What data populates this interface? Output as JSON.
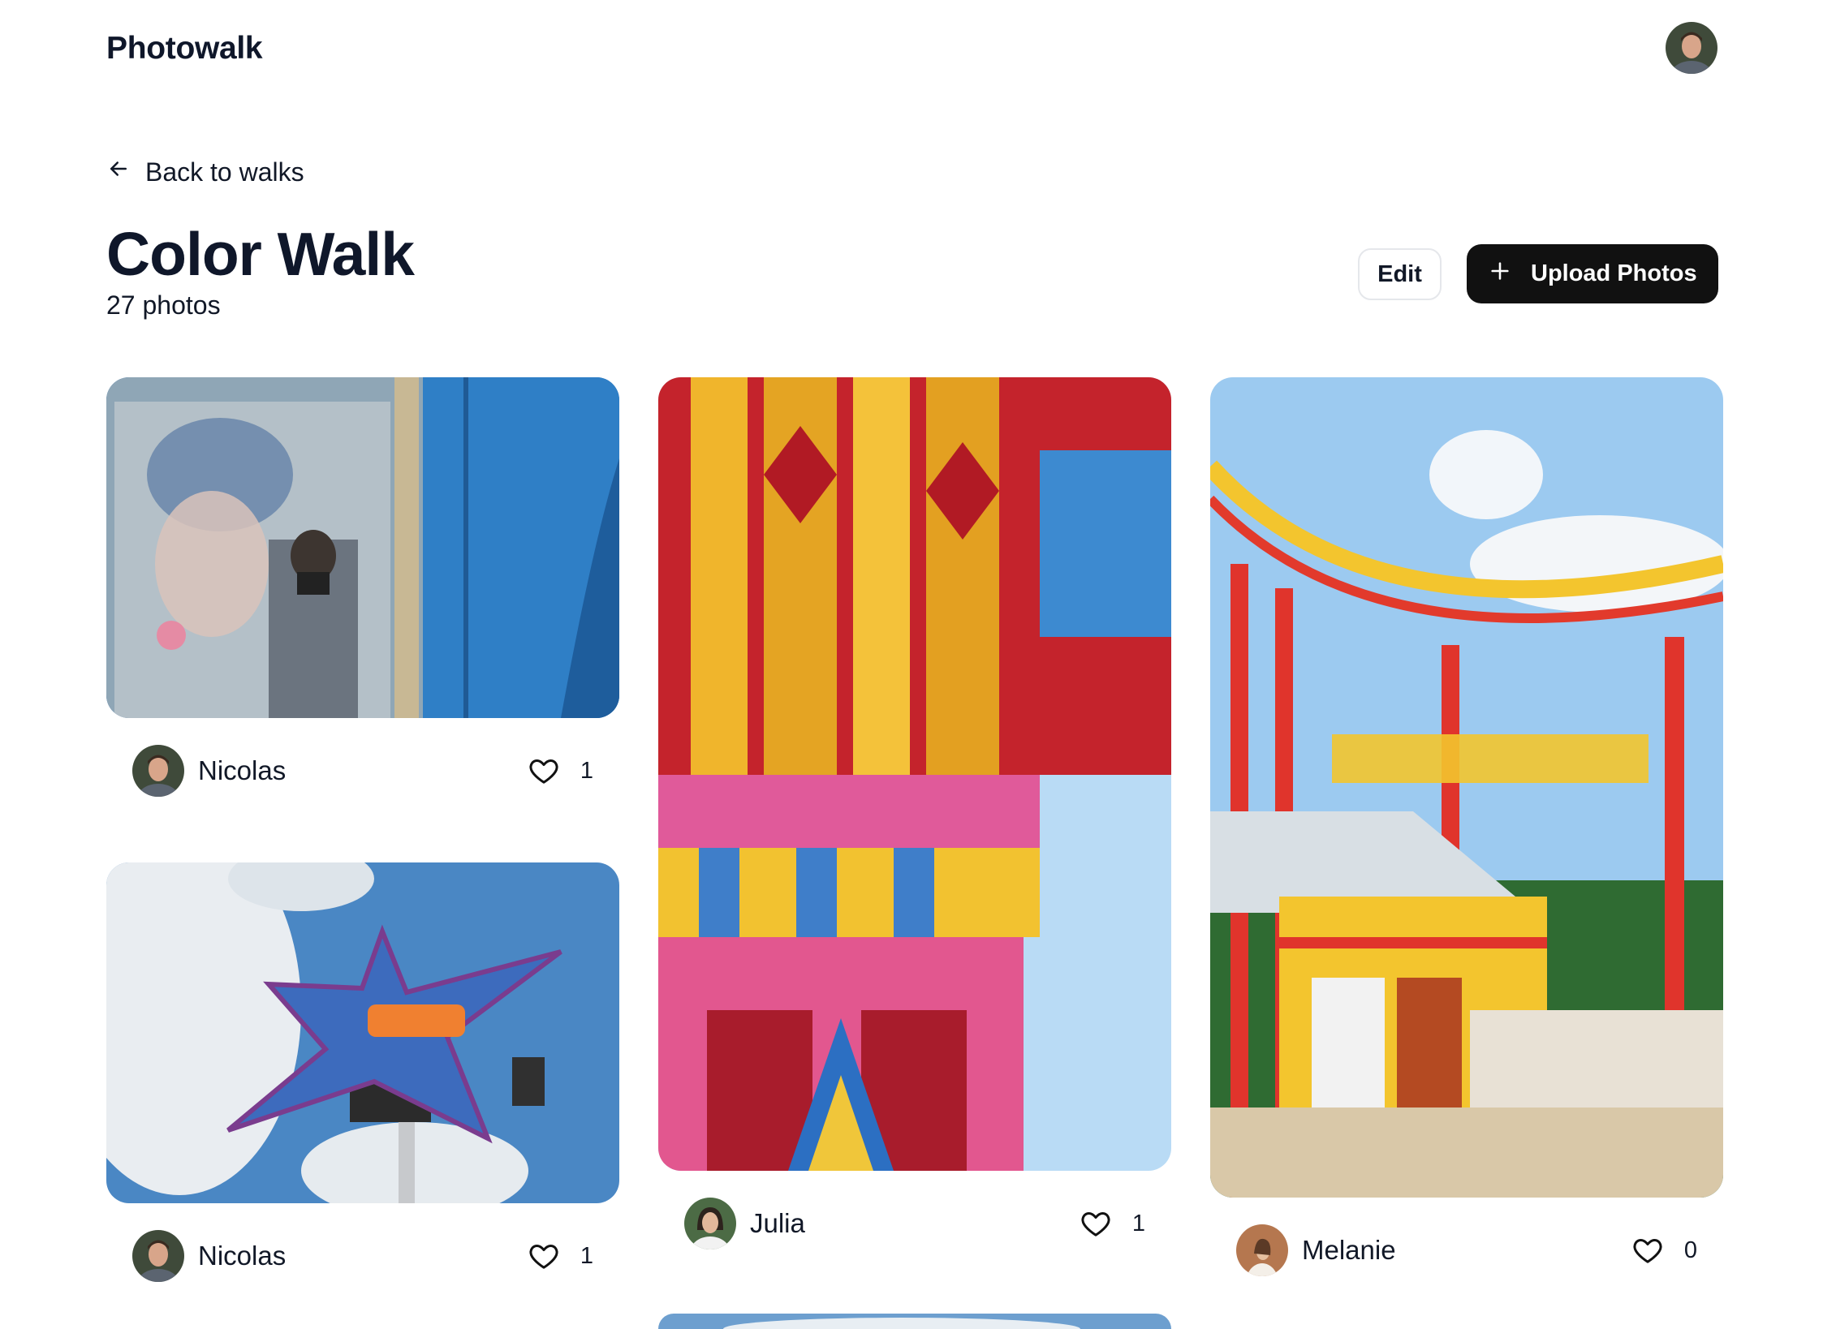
{
  "header": {
    "brand": "Photowalk"
  },
  "nav": {
    "back_label": "Back to walks"
  },
  "walk": {
    "title": "Color Walk",
    "count": "27 photos"
  },
  "actions": {
    "edit_label": "Edit",
    "upload_label": "Upload Photos"
  },
  "photos": [
    {
      "author": "Nicolas",
      "likes": "1"
    },
    {
      "author": "Nicolas",
      "likes": "1"
    },
    {
      "author": "Julia",
      "likes": "1"
    },
    {
      "author": "Melanie",
      "likes": "0"
    }
  ],
  "colors": {
    "primary_button": "#111111",
    "text": "#111827"
  },
  "icons": [
    "arrow-left-icon",
    "plus-icon",
    "heart-icon"
  ]
}
